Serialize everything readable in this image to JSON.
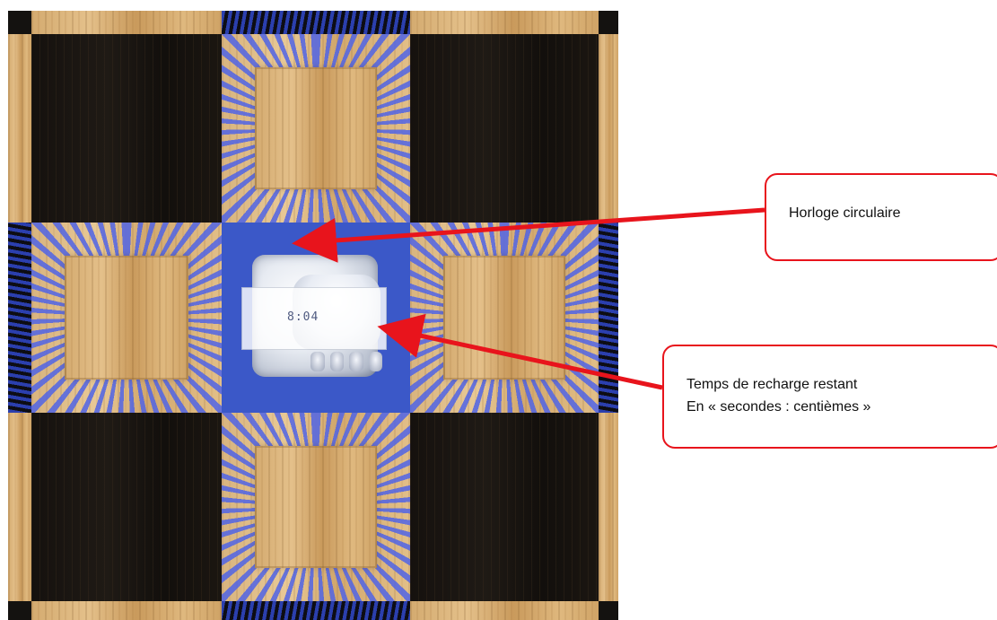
{
  "game": {
    "timer_display": "8:04"
  },
  "callouts": {
    "clock_label": "Horloge circulaire",
    "recharge_line1": "Temps de recharge restant",
    "recharge_line2": "En « secondes : centièmes »"
  },
  "colors": {
    "highlight_blue": "#3b58c8",
    "callout_red": "#e8141c"
  }
}
